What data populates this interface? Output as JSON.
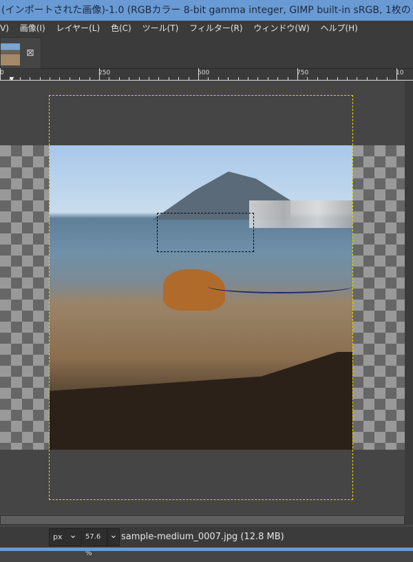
{
  "window": {
    "title": "(インポートされた画像)-1.0 (RGBカラー 8-bit gamma integer, GIMP built-in sRGB, 1枚のレ"
  },
  "menu": [
    "V)",
    "画像(I)",
    "レイヤー(L)",
    "色(C)",
    "ツール(T)",
    "フィルター(R)",
    "ウィンドウ(W)",
    "ヘルプ(H)"
  ],
  "tab": {
    "close": "⊠"
  },
  "ruler": [
    "0",
    "250",
    "500",
    "750",
    "10"
  ],
  "status": {
    "unit": "px",
    "zoom": "57.6 %",
    "file": "sample-medium_0007.jpg (12.8 MB)",
    "chevron": "⌄"
  }
}
